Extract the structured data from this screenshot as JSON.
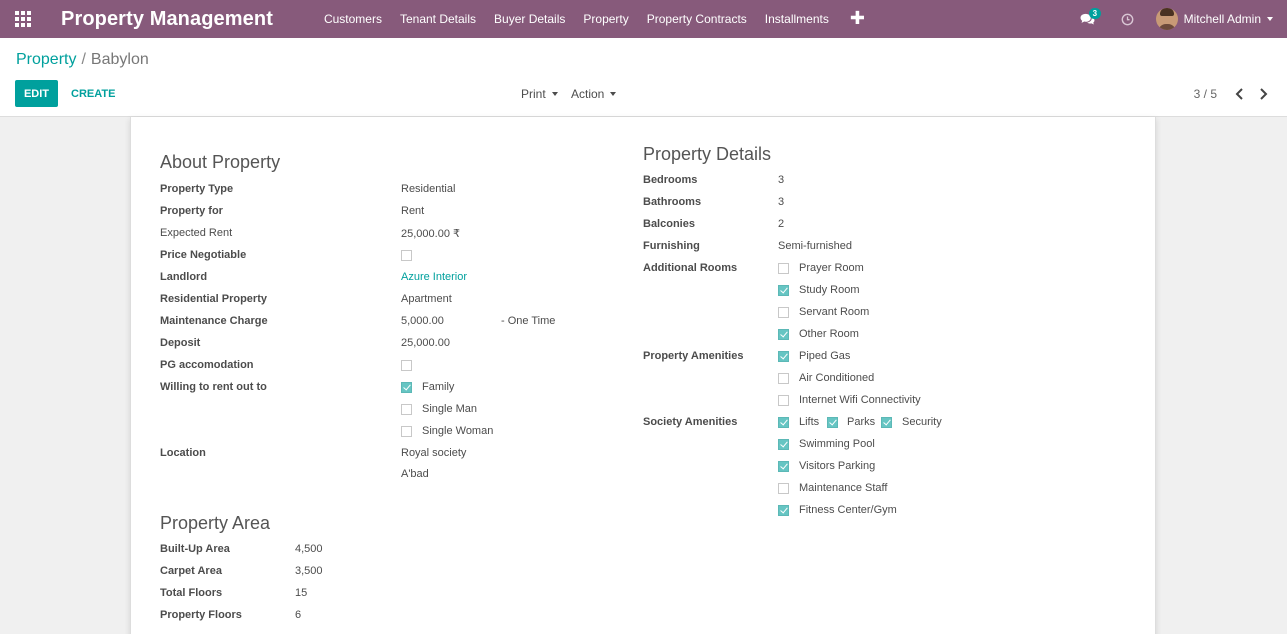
{
  "navbar": {
    "brand": "Property Management",
    "menu": [
      "Customers",
      "Tenant Details",
      "Buyer Details",
      "Property",
      "Property Contracts",
      "Installments"
    ],
    "plus": "✚",
    "messages_badge": "3",
    "user_name": "Mitchell Admin"
  },
  "breadcrumb": {
    "parent": "Property",
    "separator": "/",
    "current": "Babylon"
  },
  "buttons": {
    "edit": "EDIT",
    "create": "CREATE",
    "print": "Print",
    "action": "Action"
  },
  "pager": {
    "value": "3 / 5"
  },
  "about": {
    "title": "About Property",
    "property_type_label": "Property Type",
    "property_type": "Residential",
    "property_for_label": "Property for",
    "property_for": "Rent",
    "expected_rent_label": "Expected Rent",
    "expected_rent": "25,000.00 ₹",
    "price_negotiable_label": "Price Negotiable",
    "price_negotiable": false,
    "landlord_label": "Landlord",
    "landlord": "Azure Interior",
    "residential_property_label": "Residential Property",
    "residential_property": "Apartment",
    "maintenance_label": "Maintenance Charge",
    "maintenance": "5,000.00",
    "maintenance_period": "- One Time",
    "deposit_label": "Deposit",
    "deposit": "25,000.00",
    "pg_label": "PG accomodation",
    "pg": false,
    "willing_label": "Willing to rent out to",
    "willing": [
      {
        "label": "Family",
        "checked": true
      },
      {
        "label": "Single Man",
        "checked": false
      },
      {
        "label": "Single Woman",
        "checked": false
      }
    ],
    "location_label": "Location",
    "location_line1": "Royal society",
    "location_line2": "A'bad"
  },
  "area": {
    "title": "Property Area",
    "built_up_label": "Built-Up Area",
    "built_up": "4,500",
    "carpet_label": "Carpet Area",
    "carpet": "3,500",
    "total_floors_label": "Total Floors",
    "total_floors": "15",
    "property_floors_label": "Property Floors",
    "property_floors": "6"
  },
  "details": {
    "title": "Property Details",
    "bedrooms_label": "Bedrooms",
    "bedrooms": "3",
    "bathrooms_label": "Bathrooms",
    "bathrooms": "3",
    "balconies_label": "Balconies",
    "balconies": "2",
    "furnishing_label": "Furnishing",
    "furnishing": "Semi-furnished",
    "additional_rooms_label": "Additional Rooms",
    "additional_rooms": [
      {
        "label": "Prayer Room",
        "checked": false
      },
      {
        "label": "Study Room",
        "checked": true
      },
      {
        "label": "Servant Room",
        "checked": false
      },
      {
        "label": "Other Room",
        "checked": true
      }
    ],
    "amenities_label": "Property Amenities",
    "amenities": [
      {
        "label": "Piped Gas",
        "checked": true
      },
      {
        "label": "Air Conditioned",
        "checked": false
      },
      {
        "label": "Internet Wifi Connectivity",
        "checked": false
      }
    ],
    "society_label": "Society Amenities",
    "society_inline": [
      {
        "label": "Lifts",
        "checked": true
      },
      {
        "label": "Parks",
        "checked": true
      },
      {
        "label": "Security",
        "checked": true
      }
    ],
    "society": [
      {
        "label": "Swimming Pool",
        "checked": true
      },
      {
        "label": "Visitors Parking",
        "checked": true
      },
      {
        "label": "Maintenance Staff",
        "checked": false
      },
      {
        "label": "Fitness Center/Gym",
        "checked": true
      }
    ]
  },
  "colors": {
    "navbar": "#875a7b",
    "accent": "#00a09d"
  }
}
